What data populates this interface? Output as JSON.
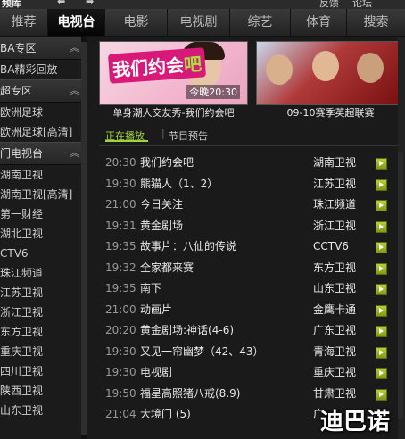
{
  "window": {
    "app_title": "频库",
    "feedback": "反馈",
    "forum": "论坛"
  },
  "nav": {
    "tabs": [
      {
        "label": "推荐"
      },
      {
        "label": "电视台"
      },
      {
        "label": "电影"
      },
      {
        "label": "电视剧"
      },
      {
        "label": "综艺"
      },
      {
        "label": "体育"
      },
      {
        "label": "搜索"
      }
    ],
    "active_index": 1
  },
  "sidebar": {
    "sections": [
      {
        "title": "BA专区",
        "items": [
          "BA精彩回放"
        ]
      },
      {
        "title": "超专区",
        "items": [
          "欧洲足球",
          "欧洲足球[高清]"
        ]
      },
      {
        "title": "门电视台",
        "items": [
          "湖南卫视",
          "湖南卫视[高清]",
          "第一财经",
          "湖北卫视",
          "CTV6",
          "珠江频道",
          "江苏卫视",
          "浙江卫视",
          "东方卫视",
          "重庆卫视",
          "四川卫视",
          "陕西卫视",
          "山东卫视"
        ]
      }
    ],
    "collapse_icon": "double-chevron-up-icon"
  },
  "banners": [
    {
      "logo_text": "我们约会",
      "logo_sub": "吧",
      "time": "今晚20:30",
      "caption": "单身潮人交友秀-我们约会吧"
    },
    {
      "caption": "09-10赛季英超联赛"
    }
  ],
  "program_tabs": {
    "active": "正在播放",
    "other": "节目预告"
  },
  "programs": [
    {
      "time": "20:30",
      "title": "我们约会吧",
      "channel": "湖南卫视"
    },
    {
      "time": "19:30",
      "title": "熊猫人（1、2）",
      "channel": "江苏卫视"
    },
    {
      "time": "21:00",
      "title": "今日关注",
      "channel": "珠江频道"
    },
    {
      "time": "19:31",
      "title": "黄金剧场",
      "channel": "浙江卫视"
    },
    {
      "time": "19:35",
      "title": "故事片：八仙的传说",
      "channel": "CCTV6"
    },
    {
      "time": "19:32",
      "title": "全家都来赛",
      "channel": "东方卫视"
    },
    {
      "time": "19:35",
      "title": "南下",
      "channel": "山东卫视"
    },
    {
      "time": "21:00",
      "title": "动画片",
      "channel": "金鹰卡通"
    },
    {
      "time": "20:20",
      "title": "黄金剧场:神话(4-6)",
      "channel": "广东卫视"
    },
    {
      "time": "19:30",
      "title": "又见一帘幽梦（42、43）",
      "channel": "青海卫视"
    },
    {
      "time": "19:30",
      "title": "电视剧",
      "channel": "重庆卫视"
    },
    {
      "time": "19:50",
      "title": "福星高照猪八戒(8.9)",
      "channel": "甘肃卫视"
    },
    {
      "time": "21:04",
      "title": "大境门 (5)",
      "channel": "广"
    }
  ],
  "watermark": "迪巴诺",
  "colors": {
    "accent_green": "#9fd43a",
    "play_button": "#8fab1e"
  }
}
